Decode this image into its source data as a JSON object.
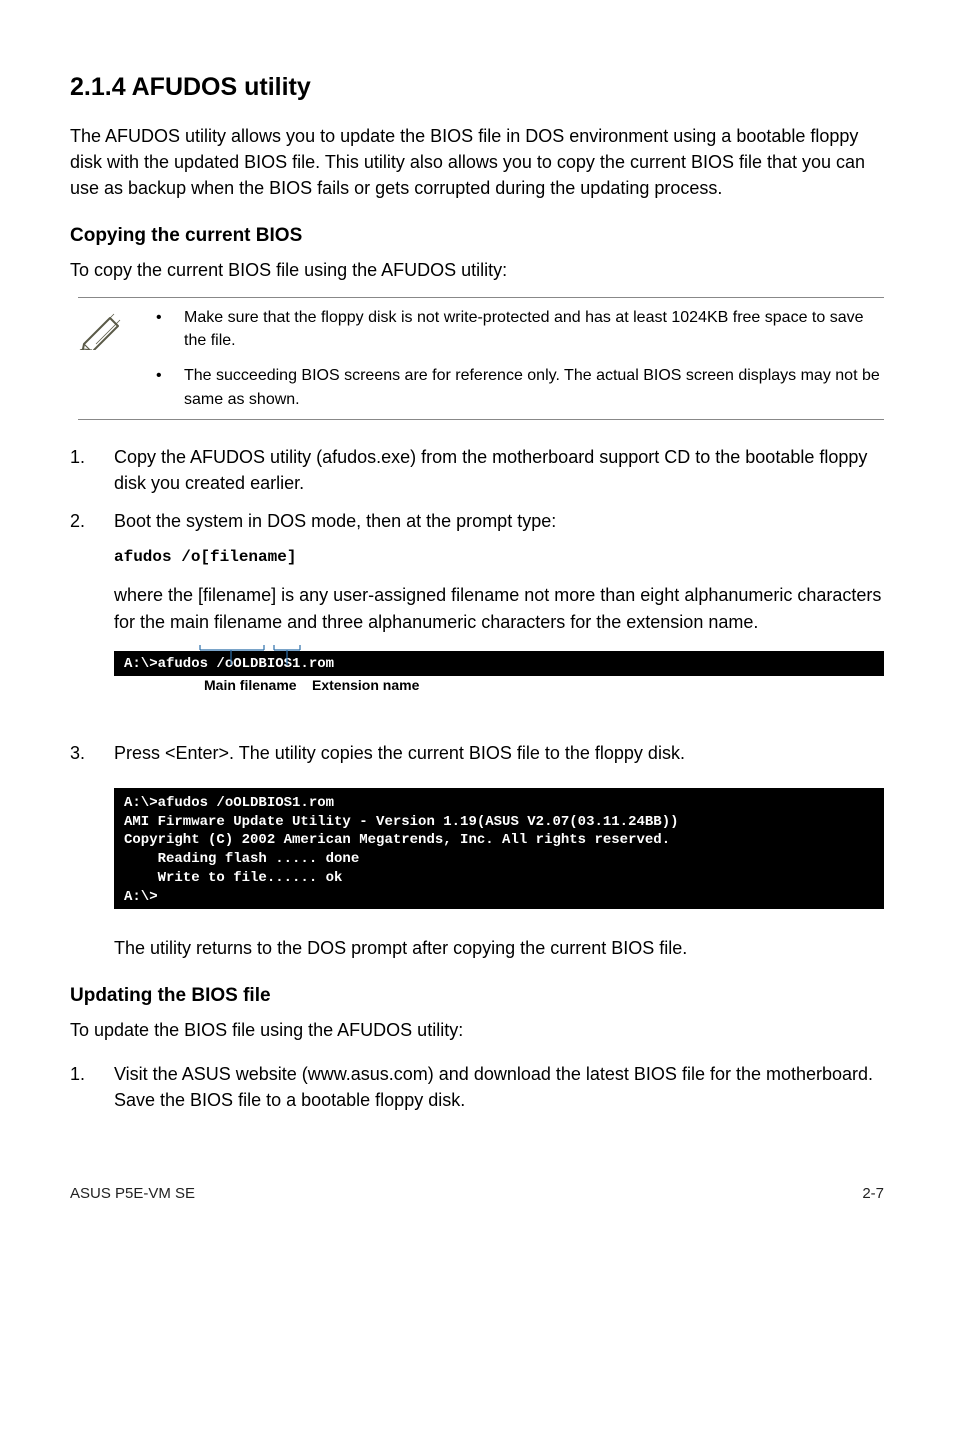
{
  "heading": "2.1.4      AFUDOS utility",
  "intro": "The AFUDOS utility allows you to update the BIOS file in DOS environment using a bootable floppy disk with the updated BIOS file. This utility also allows you to copy the current BIOS file that you can use as backup when the BIOS fails or gets corrupted during the updating process.",
  "copy_heading": "Copying the current BIOS",
  "copy_intro": "To copy the current BIOS file using the AFUDOS utility:",
  "notes": [
    "Make sure that the floppy disk is not write-protected and has at least 1024KB free space to save the file.",
    "The succeeding BIOS screens are for reference only. The actual BIOS screen displays may not be same as shown."
  ],
  "steps_a": [
    "Copy the AFUDOS utility (afudos.exe) from the motherboard support CD to the bootable floppy disk you created earlier.",
    "Boot the system in DOS mode, then at the prompt type:"
  ],
  "cmd1": "afudos /o[filename]",
  "where_text": "where the [filename] is any user-assigned filename not more than eight alphanumeric characters  for the main filename and three alphanumeric characters for the extension name.",
  "term1": "A:\\>afudos /oOLDBIOS1.rom",
  "anno_main": "Main filename",
  "anno_ext": "Extension name",
  "step3": "Press <Enter>. The utility copies the current BIOS file to the floppy disk.",
  "term2": "A:\\>afudos /oOLDBIOS1.rom\nAMI Firmware Update Utility - Version 1.19(ASUS V2.07(03.11.24BB))\nCopyright (C) 2002 American Megatrends, Inc. All rights reserved.\n    Reading flash ..... done\n    Write to file...... ok\nA:\\>",
  "after_term2": "The utility returns to the DOS prompt after copying the current BIOS file.",
  "update_heading": "Updating the BIOS file",
  "update_intro": "To update the BIOS file using the AFUDOS utility:",
  "update_step1": "Visit the ASUS website (www.asus.com) and download the latest BIOS file for the motherboard. Save the BIOS file to a bootable floppy disk.",
  "footer_left": "ASUS P5E-VM SE",
  "footer_right": "2-7"
}
